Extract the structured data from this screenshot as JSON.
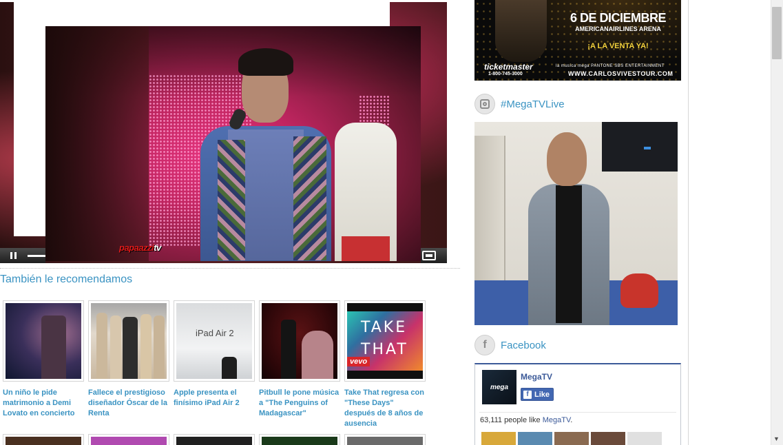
{
  "video": {
    "watermark_main": "papaazzi",
    "watermark_tv": "tv"
  },
  "recommendations": {
    "heading": "También le recomendamos",
    "items": [
      {
        "caption": "Un niño le pide matrimonio a Demi Lovato en concierto"
      },
      {
        "caption": "Fallece el prestigioso diseñador Óscar de la Renta"
      },
      {
        "caption": "Apple presenta el finísimo iPad Air 2",
        "thumb_text": "iPad Air 2"
      },
      {
        "caption": "Pitbull le pone música a \"The Penguins of Madagascar\""
      },
      {
        "caption": "Take That regresa con \"These Days\" después de 8 años de ausencia",
        "thumb_text": "TAKE THAT",
        "thumb_badge": "vevo"
      }
    ]
  },
  "sidebar": {
    "ad": {
      "date": "6 DE DICIEMBRE",
      "venue": "AMERICANAIRLINES ARENA",
      "sale": "¡A LA VENTA YA!",
      "ticketmaster": "ticketmaster",
      "phone": "1-800-745-3000",
      "sponsors": "la musica  mega  PANTONE  SBS ENTERTAINMENT",
      "url": "WWW.CARLOSVIVESTOUR.COM"
    },
    "instagram": {
      "title": "#MegaTVLive"
    },
    "facebook": {
      "title": "Facebook",
      "page_name": "MegaTV",
      "logo_text": "mega",
      "like_label": "Like",
      "count_text": "63,111 people like ",
      "count_link": "MegaTV",
      "count_end": "."
    }
  },
  "colors": {
    "link_blue": "#3a93c2",
    "facebook_blue": "#3b5998"
  }
}
